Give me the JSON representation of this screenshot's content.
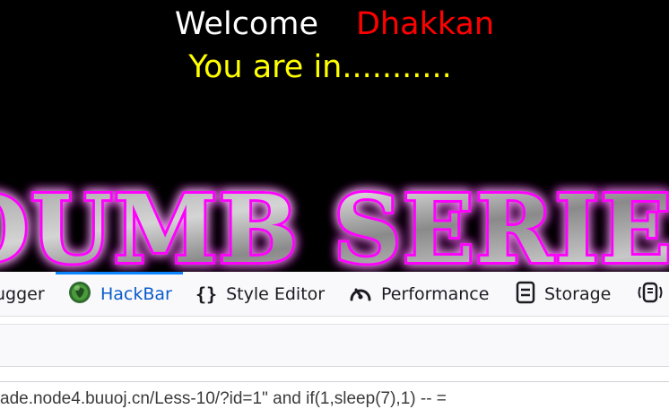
{
  "page": {
    "welcome_word": "Welcome",
    "welcome_name": "Dhakkan",
    "status": "You are in...........",
    "banner_text": "DUMB SERIES",
    "colors": {
      "background": "#000000",
      "welcome": "#ffffff",
      "name": "#ff0000",
      "status": "#ffff00",
      "banner_glow": "#ff00ff"
    }
  },
  "devtools": {
    "tabs": [
      {
        "label": "ugger",
        "icon": "debugger-icon"
      },
      {
        "label": "HackBar",
        "icon": "hackbar-logo-icon",
        "active": true
      },
      {
        "label": "Style Editor",
        "icon": "curly-braces-icon"
      },
      {
        "label": "Performance",
        "icon": "gauge-icon"
      },
      {
        "label": "Storage",
        "icon": "storage-icon"
      },
      {
        "label": "",
        "icon": "accessibility-icon"
      }
    ],
    "accent": "#0a84ff"
  },
  "hackbar": {
    "url_value": "ade.node4.buuoj.cn/Less-10/?id=1\" and if(1,sleep(7),1) -- ="
  }
}
